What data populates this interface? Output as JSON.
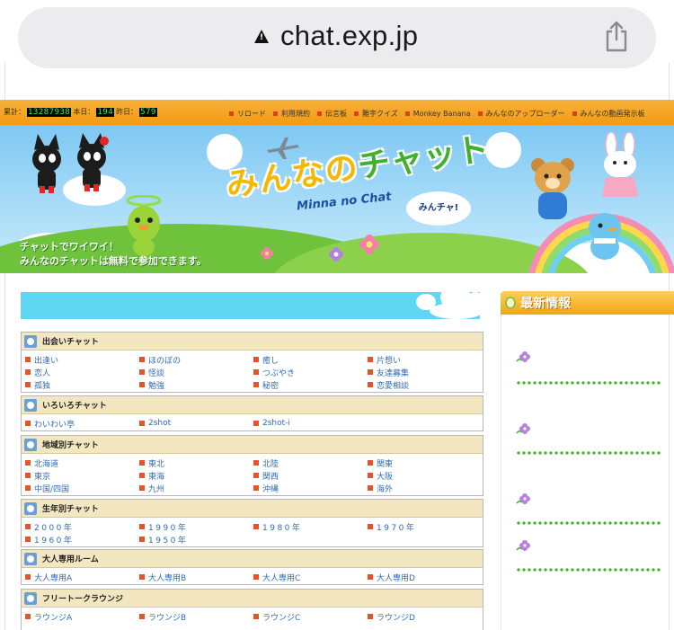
{
  "browser": {
    "url": "chat.exp.jp",
    "warning_icon": "warning-triangle-icon",
    "share_icon": "share-icon"
  },
  "counter": {
    "total_label": "累計：",
    "total_value": "13287938",
    "today_label": "本日：",
    "today_value": "194",
    "yesterday_label": "昨日：",
    "yesterday_value": "579"
  },
  "top_links": [
    "リロード",
    "利用規約",
    "伝言板",
    "難字クイズ",
    "Monkey Banana",
    "みんなのアップローダー",
    "みんなの動画発示板"
  ],
  "banner": {
    "title_part1": "みんなの",
    "title_part2": "チャット",
    "subtitle": "Minna no Chat",
    "bubble": "みんチャ!",
    "tagline_line1": "チャットでワイワイ！",
    "tagline_line2": "みんなのチャットは無料で参加できます。"
  },
  "sections": [
    {
      "title": "出会いチャット",
      "items": [
        "出逢い",
        "ほのぼの",
        "癒し",
        "片想い",
        "恋人",
        "怪談",
        "つぶやき",
        "友達募集",
        "孤独",
        "勉強",
        "秘密",
        "恋愛相談"
      ]
    },
    {
      "title": "いろいろチャット",
      "items": [
        "わいわい亭",
        "2shot",
        "2shot-i"
      ]
    },
    {
      "title": "地域別チャット",
      "items": [
        "北海道",
        "東北",
        "北陸",
        "関東",
        "東京",
        "東海",
        "関西",
        "大阪",
        "中国/四国",
        "九州",
        "沖縄",
        "海外"
      ]
    },
    {
      "title": "生年別チャット",
      "items": [
        "2000年",
        "1990年",
        "1980年",
        "1970年",
        "1960年",
        "1950年"
      ]
    },
    {
      "title": "大人専用ルーム",
      "items": [
        "大人専用A",
        "大人専用B",
        "大人専用C",
        "大人専用D"
      ]
    },
    {
      "title": "フリートークラウンジ",
      "items": [
        "ラウンジA",
        "ラウンジB",
        "ラウンジC",
        "ラウンジD"
      ]
    }
  ],
  "sidebar": {
    "title": "最新情報"
  },
  "colors": {
    "topstrip": "#f39a12",
    "link_blue": "#2f6bb3",
    "bullet_red": "#e2542a",
    "section_header": "#f3e7c1",
    "content_header": "#5fd6f2",
    "dot_green": "#3fb52c"
  }
}
